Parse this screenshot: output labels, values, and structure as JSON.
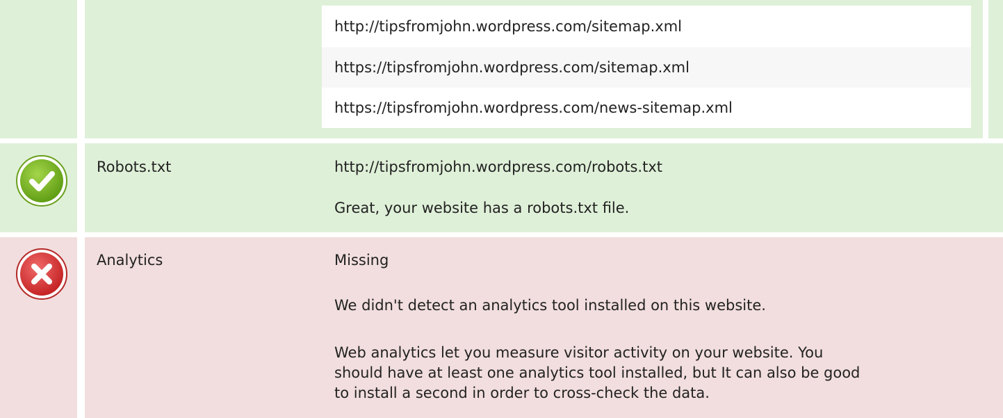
{
  "sitemaps": {
    "urls": [
      "http://tipsfromjohn.wordpress.com/sitemap.xml",
      "https://tipsfromjohn.wordpress.com/sitemap.xml",
      "https://tipsfromjohn.wordpress.com/news-sitemap.xml"
    ]
  },
  "robots": {
    "status": "pass",
    "status_icon": "check-icon",
    "status_color": "#7cb518",
    "label": "Robots.txt",
    "url": "http://tipsfromjohn.wordpress.com/robots.txt",
    "message": "Great, your website has a robots.txt file."
  },
  "analytics": {
    "status": "fail",
    "status_icon": "cross-icon",
    "status_color": "#d83a3a",
    "label": "Analytics",
    "value": "Missing",
    "message": "We didn't detect an analytics tool installed on this website.",
    "advice": "Web analytics let you measure visitor activity on your website. You should have at least one analytics tool installed, but It can also be good to install a second in order to cross-check the data."
  },
  "colors": {
    "pass_bg": "#dff0d8",
    "fail_bg": "#f2dede"
  }
}
